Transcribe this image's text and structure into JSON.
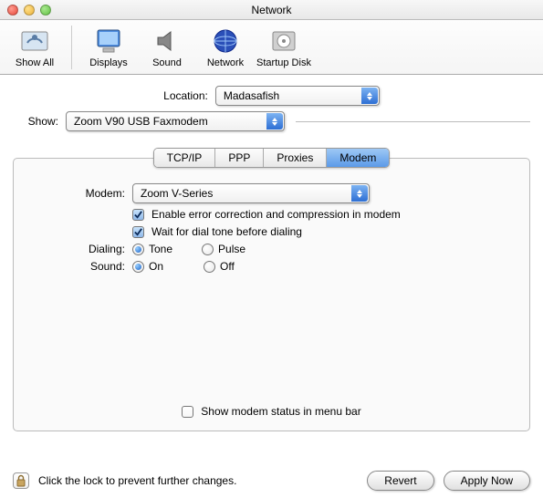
{
  "window": {
    "title": "Network"
  },
  "toolbar": {
    "show_all": "Show All",
    "displays": "Displays",
    "sound": "Sound",
    "network": "Network",
    "startup_disk": "Startup Disk"
  },
  "location": {
    "label": "Location:",
    "value": "Madasafish"
  },
  "show": {
    "label": "Show:",
    "value": "Zoom V90 USB Faxmodem"
  },
  "tabs": {
    "tcpip": "TCP/IP",
    "ppp": "PPP",
    "proxies": "Proxies",
    "modem": "Modem",
    "active": "modem"
  },
  "modem": {
    "label": "Modem:",
    "value": "Zoom V-Series",
    "error_correction": {
      "label": "Enable error correction and compression in modem",
      "checked": true
    },
    "wait_dialtone": {
      "label": "Wait for dial tone before dialing",
      "checked": true
    },
    "dialing": {
      "label": "Dialing:",
      "options": {
        "tone": "Tone",
        "pulse": "Pulse"
      },
      "selected": "tone"
    },
    "sound": {
      "label": "Sound:",
      "options": {
        "on": "On",
        "off": "Off"
      },
      "selected": "on"
    },
    "menubar": {
      "label": "Show modem status in menu bar",
      "checked": false
    }
  },
  "footer": {
    "lock_text": "Click the lock to prevent further changes.",
    "revert": "Revert",
    "apply": "Apply Now"
  }
}
